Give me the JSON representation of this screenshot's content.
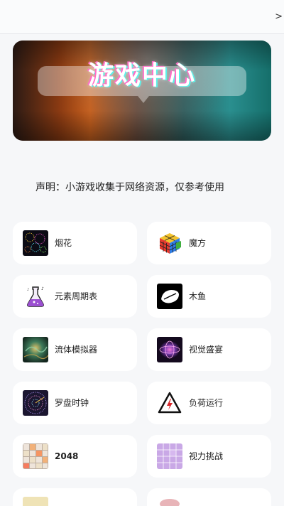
{
  "topbar": {
    "more_glyph": ">"
  },
  "banner": {
    "title": "游戏中心"
  },
  "notice": "声明：小游戏收集于网络资源，仅参考使用",
  "games": [
    {
      "label": "烟花",
      "icon": "fireworks-icon"
    },
    {
      "label": "魔方",
      "icon": "rubiks-cube-icon"
    },
    {
      "label": "元素周期表",
      "icon": "chemistry-flask-icon"
    },
    {
      "label": "木鱼",
      "icon": "wooden-fish-icon"
    },
    {
      "label": "流体模拟器",
      "icon": "fluid-simulator-icon"
    },
    {
      "label": "视觉盛宴",
      "icon": "visual-feast-icon"
    },
    {
      "label": "罗盘时钟",
      "icon": "compass-clock-icon"
    },
    {
      "label": "负荷运行",
      "icon": "high-voltage-warning-icon"
    },
    {
      "label": "2048",
      "icon": "2048-grid-icon"
    },
    {
      "label": "视力挑战",
      "icon": "vision-challenge-icon"
    },
    {
      "label": "",
      "icon": "tile-game-icon"
    },
    {
      "label": "",
      "icon": "pink-game-icon"
    }
  ]
}
